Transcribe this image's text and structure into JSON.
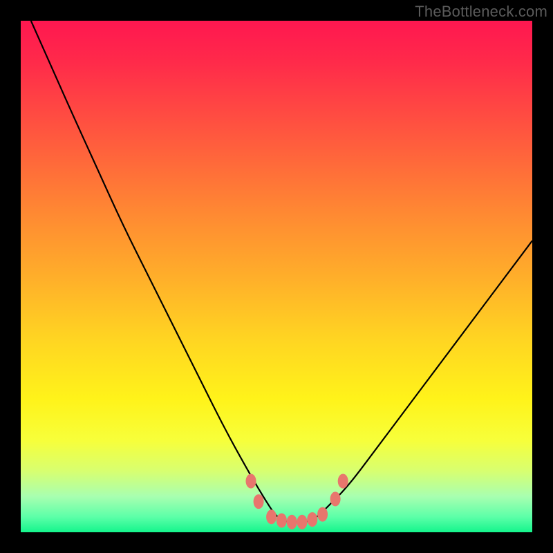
{
  "watermark": "TheBottleneck.com",
  "colors": {
    "background": "#000000",
    "gradient_top": "#ff1750",
    "gradient_mid": "#ffd422",
    "gradient_bottom": "#14f58c",
    "curve": "#000000",
    "marker": "#e8766d"
  },
  "chart_data": {
    "type": "line",
    "title": "",
    "xlabel": "",
    "ylabel": "",
    "xlim": [
      0,
      100
    ],
    "ylim": [
      0,
      100
    ],
    "series": [
      {
        "name": "bottleneck-curve",
        "x": [
          2,
          6,
          10,
          15,
          20,
          25,
          30,
          35,
          40,
          45,
          48,
          50,
          52,
          54,
          56,
          58,
          60,
          64,
          70,
          76,
          82,
          88,
          94,
          100
        ],
        "y": [
          100,
          91,
          82,
          71,
          60,
          50,
          40,
          30,
          20,
          11,
          6,
          3,
          2,
          2,
          2,
          3,
          5,
          9,
          17,
          25,
          33,
          41,
          49,
          57
        ]
      }
    ],
    "markers": {
      "name": "trough-markers",
      "x": [
        45,
        46.5,
        49,
        51,
        53,
        55,
        57,
        59,
        61.5,
        63
      ],
      "y": [
        10,
        6,
        3,
        2.3,
        2,
        2,
        2.5,
        3.5,
        6.5,
        10
      ]
    }
  }
}
